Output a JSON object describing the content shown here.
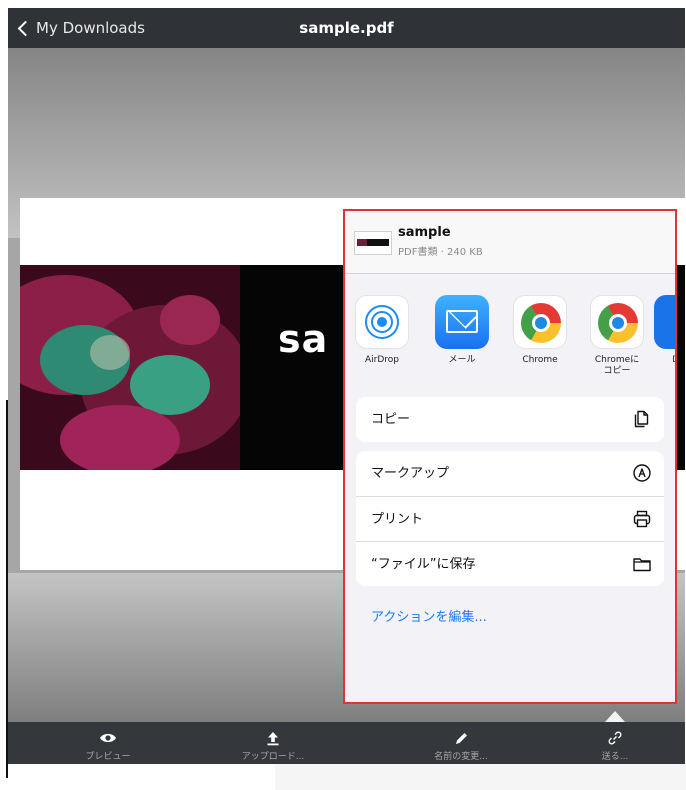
{
  "nav": {
    "back_label": "My Downloads",
    "title": "sample.pdf"
  },
  "pdf": {
    "banner_text": "sa"
  },
  "share_sheet": {
    "file_name": "sample",
    "file_meta": "PDF書類 · 240 KB",
    "apps": [
      {
        "label": "AirDrop",
        "icon": "airdrop-icon"
      },
      {
        "label": "メール",
        "icon": "mail-icon"
      },
      {
        "label": "Chrome",
        "icon": "chrome-icon"
      },
      {
        "label": "Chromeに\nコピー",
        "icon": "chrome-icon"
      },
      {
        "label": "Doc",
        "icon": "docs-icon"
      }
    ],
    "copy_label": "コピー",
    "actions": [
      {
        "label": "マークアップ",
        "icon": "markup-icon"
      },
      {
        "label": "プリント",
        "icon": "print-icon"
      },
      {
        "label": "“ファイル”に保存",
        "icon": "folder-icon"
      }
    ],
    "edit_actions_label": "アクションを編集..."
  },
  "toolbar": {
    "items": [
      {
        "label": "プレビュー",
        "icon": "eye-icon"
      },
      {
        "label": "アップロード...",
        "icon": "upload-icon"
      },
      {
        "label": "名前の変更...",
        "icon": "pencil-icon"
      },
      {
        "label": "送る...",
        "icon": "link-icon"
      }
    ]
  },
  "colors": {
    "nav_bar": "#2f3236",
    "toolbar": "#34373b",
    "sheet_background": "#f2f2f7",
    "highlight_border": "#e03434",
    "link_blue": "#1a7cf5"
  }
}
